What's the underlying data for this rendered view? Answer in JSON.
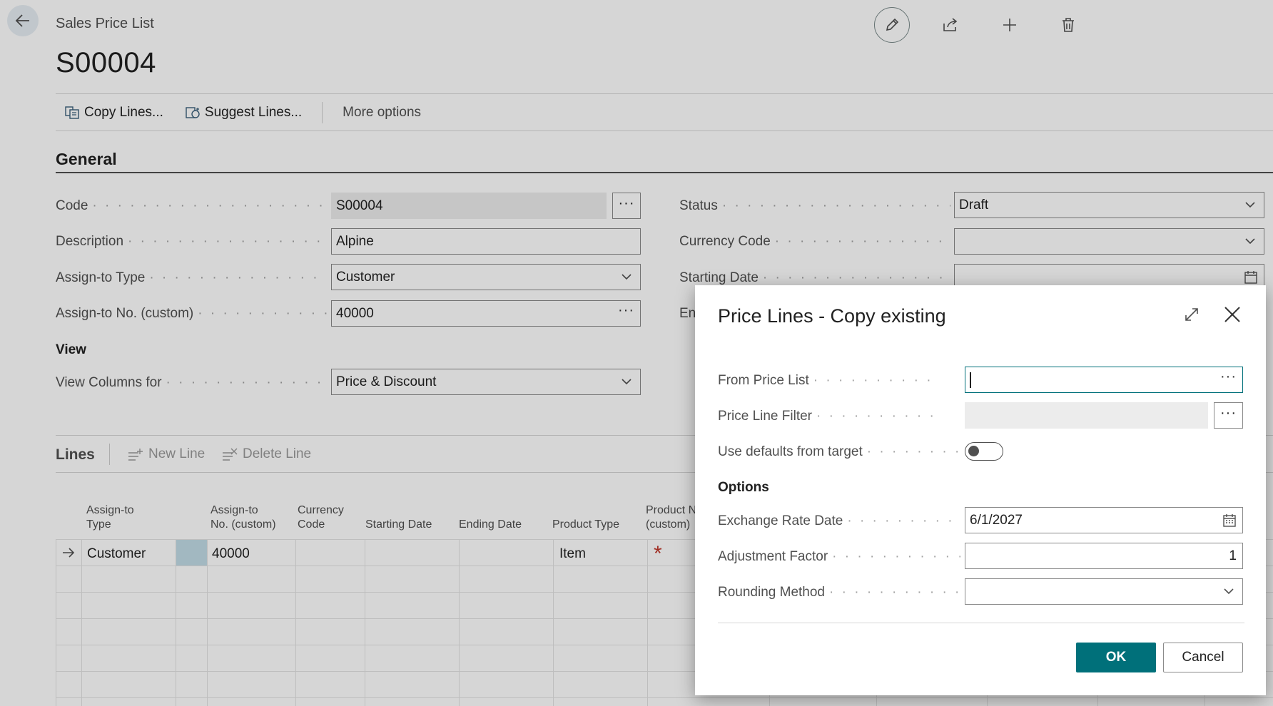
{
  "header": {
    "caption": "Sales Price List",
    "title": "S00004"
  },
  "actions": {
    "copy_lines": "Copy Lines...",
    "suggest_lines": "Suggest Lines...",
    "more_options": "More options"
  },
  "general": {
    "section_title": "General",
    "code": {
      "label": "Code",
      "value": "S00004"
    },
    "description": {
      "label": "Description",
      "value": "Alpine"
    },
    "assign_to_type": {
      "label": "Assign-to Type",
      "value": "Customer"
    },
    "assign_to_no": {
      "label": "Assign-to No. (custom)",
      "value": "40000"
    },
    "view_heading": "View",
    "view_columns": {
      "label": "View Columns for",
      "value": "Price & Discount"
    },
    "status": {
      "label": "Status",
      "value": "Draft"
    },
    "currency_code": {
      "label": "Currency Code",
      "value": ""
    },
    "starting_date": {
      "label": "Starting Date",
      "value": ""
    },
    "ending_date_partial": "En"
  },
  "lines": {
    "title": "Lines",
    "new_line": "New Line",
    "delete_line": "Delete Line",
    "columns": [
      {
        "line1": "Assign-to",
        "line2": "Type"
      },
      {
        "line1": "Assign-to",
        "line2": "No. (custom)"
      },
      {
        "line1": "Currency",
        "line2": "Code"
      },
      {
        "line1": "",
        "line2": "Starting Date"
      },
      {
        "line1": "",
        "line2": "Ending Date"
      },
      {
        "line1": "",
        "line2": "Product Type"
      },
      {
        "line1": "Product N",
        "line2": "(custom)"
      }
    ],
    "row1": {
      "assign_to_type": "Customer",
      "assign_to_no": "40000",
      "product_type": "Item",
      "required_marker": "*"
    }
  },
  "dialog": {
    "title": "Price Lines - Copy existing",
    "from_price_list": {
      "label": "From Price List",
      "value": ""
    },
    "price_line_filter": {
      "label": "Price Line Filter",
      "value": ""
    },
    "use_defaults": {
      "label": "Use defaults from target",
      "on": false
    },
    "options_heading": "Options",
    "exchange_rate_date": {
      "label": "Exchange Rate Date",
      "value": "6/1/2027"
    },
    "adjustment_factor": {
      "label": "Adjustment Factor",
      "value": "1"
    },
    "rounding_method": {
      "label": "Rounding Method",
      "value": ""
    },
    "ok": "OK",
    "cancel": "Cancel"
  },
  "icons": {
    "back": "arrow-left-icon",
    "edit": "pencil-icon",
    "share": "share-icon",
    "new": "plus-icon",
    "delete": "trash-icon",
    "expand": "expand-icon",
    "close": "close-icon",
    "calendar": "calendar-icon"
  },
  "colors": {
    "accent": "#00707a",
    "required": "#c0392b"
  }
}
